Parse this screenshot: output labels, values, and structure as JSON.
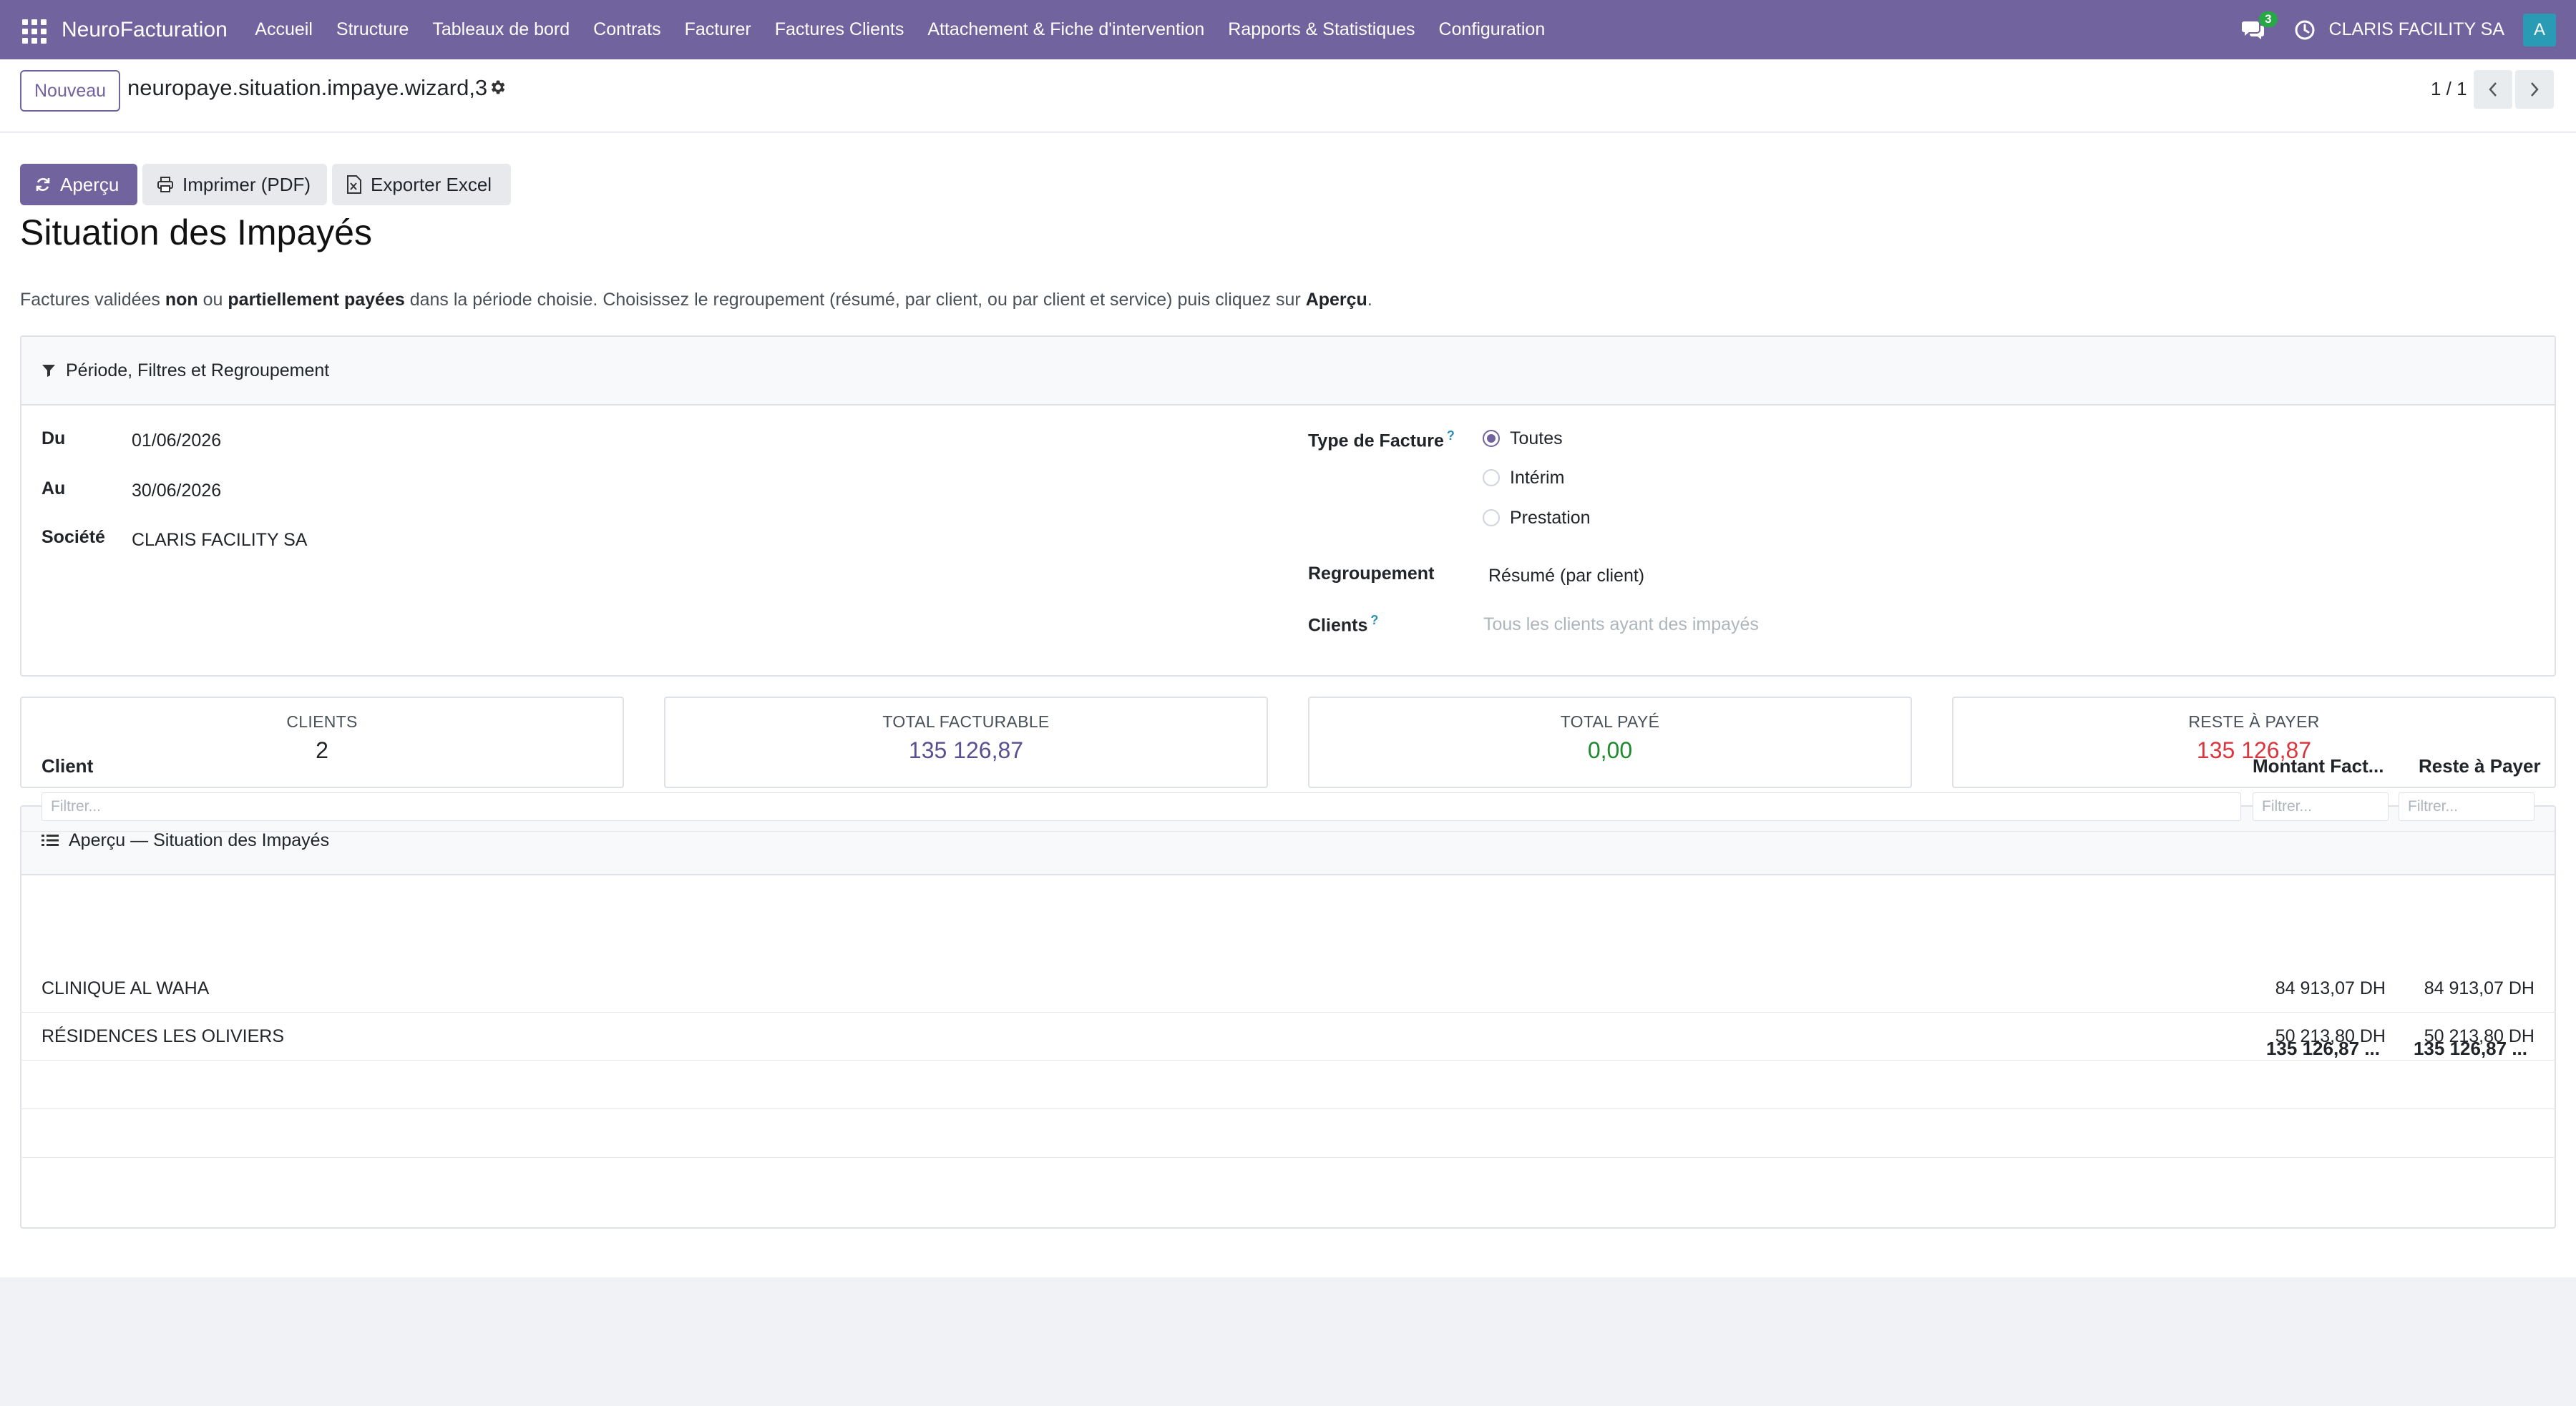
{
  "navbar": {
    "brand": "NeuroFacturation",
    "menu": [
      "Accueil",
      "Structure",
      "Tableaux de bord",
      "Contrats",
      "Facturer",
      "Factures Clients",
      "Attachement & Fiche d'intervention",
      "Rapports & Statistiques",
      "Configuration"
    ],
    "chat_badge": "3",
    "company": "CLARIS FACILITY SA",
    "avatar_letter": "A"
  },
  "control_panel": {
    "new_button": "Nouveau",
    "record_name": "neuropaye.situation.impaye.wizard,3",
    "pager": "1 / 1"
  },
  "actions": {
    "preview": "Aperçu",
    "print": "Imprimer (PDF)",
    "export": "Exporter Excel"
  },
  "page": {
    "title": "Situation des Impayés",
    "desc_1": "Factures validées ",
    "desc_b1": "non",
    "desc_2": " ou ",
    "desc_b2": "partiellement payées",
    "desc_3": " dans la période choisie. Choisissez le regroupement (résumé, par client, ou par client et service) puis cliquez sur ",
    "desc_b3": "Aperçu",
    "desc_4": "."
  },
  "filters": {
    "header": "Période, Filtres et Regroupement",
    "du_label": "Du",
    "du_value": "01/06/2026",
    "au_label": "Au",
    "au_value": "30/06/2026",
    "societe_label": "Société",
    "societe_value": "CLARIS FACILITY SA",
    "type_label": "Type de Facture",
    "type_options": [
      "Toutes",
      "Intérim",
      "Prestation"
    ],
    "type_selected": "Toutes",
    "regroupement_label": "Regroupement",
    "regroupement_value": "Résumé (par client)",
    "clients_label": "Clients",
    "clients_placeholder": "Tous les clients ayant des impayés",
    "help_mark": "?"
  },
  "stats": [
    {
      "label": "CLIENTS",
      "value": "2",
      "color": "#212529"
    },
    {
      "label": "TOTAL FACTURABLE",
      "value": "135 126,87",
      "color": "#5b4f8f"
    },
    {
      "label": "TOTAL PAYÉ",
      "value": "0,00",
      "color": "#1e8a2e"
    },
    {
      "label": "RESTE À PAYER",
      "value": "135 126,87",
      "color": "#d9363e"
    }
  ],
  "preview": {
    "header": "Aperçu — Situation des Impayés",
    "columns": [
      "Client",
      "Montant Fact...",
      "Reste à Payer"
    ],
    "filter_placeholder": "Filtrer...",
    "rows": [
      {
        "client": "CLINIQUE AL WAHA",
        "montant": "84 913,07 DH",
        "reste": "84 913,07 DH"
      },
      {
        "client": "RÉSIDENCES LES OLIVIERS",
        "montant": "50 213,80 DH",
        "reste": "50 213,80 DH"
      }
    ],
    "total_montant": "135 126,87 ...",
    "total_reste": "135 126,87 ..."
  },
  "colors": {
    "brand": "#71639e",
    "info": "#2a8fb4"
  }
}
